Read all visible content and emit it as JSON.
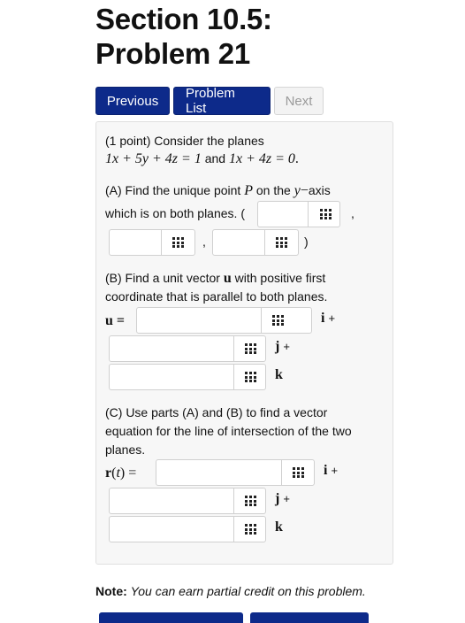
{
  "page": {
    "title_line1": "Section 10.5:",
    "title_line2": "Problem 21"
  },
  "nav": {
    "previous": "Previous",
    "problem_list": "Problem List",
    "next": "Next"
  },
  "problem": {
    "intro": "(1 point) Consider the planes",
    "plane1": "1x + 5y + 4z = 1",
    "and": "and",
    "plane2": "1x + 4z = 0",
    "partA_line1_pre": "(A) Find the unique point",
    "partA_P": "P",
    "partA_line1_mid": "on the",
    "partA_y": "y",
    "partA_line1_post": "axis",
    "partA_line2": "which is on both planes. (",
    "comma": ",",
    "close_paren": ")",
    "partB_line1_pre": "(B) Find a unit vector",
    "partB_u": "u",
    "partB_line1_post": "with positive first",
    "partB_line2": "coordinate that is parallel to both planes.",
    "u_eq": "u =",
    "partC_line1": "(C) Use parts (A) and (B) to find a vector",
    "partC_line2": "equation for the line of intersection of the two",
    "partC_line3": "planes.",
    "r_eq": "r(t) =",
    "i_suffix": "i",
    "j_suffix": "j",
    "k_suffix": "k",
    "plus": "+"
  },
  "answers": {
    "a_x": "",
    "a_y": "",
    "a_z": "",
    "b_i": "",
    "b_j": "",
    "b_k": "",
    "c_i": "",
    "c_j": "",
    "c_k": ""
  },
  "note": {
    "label": "Note:",
    "text": "You can earn partial credit on this problem."
  },
  "icons": {
    "answer_tool": "grid-icon"
  },
  "colors": {
    "primary": "#0d2a8a",
    "disabled_text": "#9a9a9a",
    "panel_bg": "#f7f7f7"
  }
}
